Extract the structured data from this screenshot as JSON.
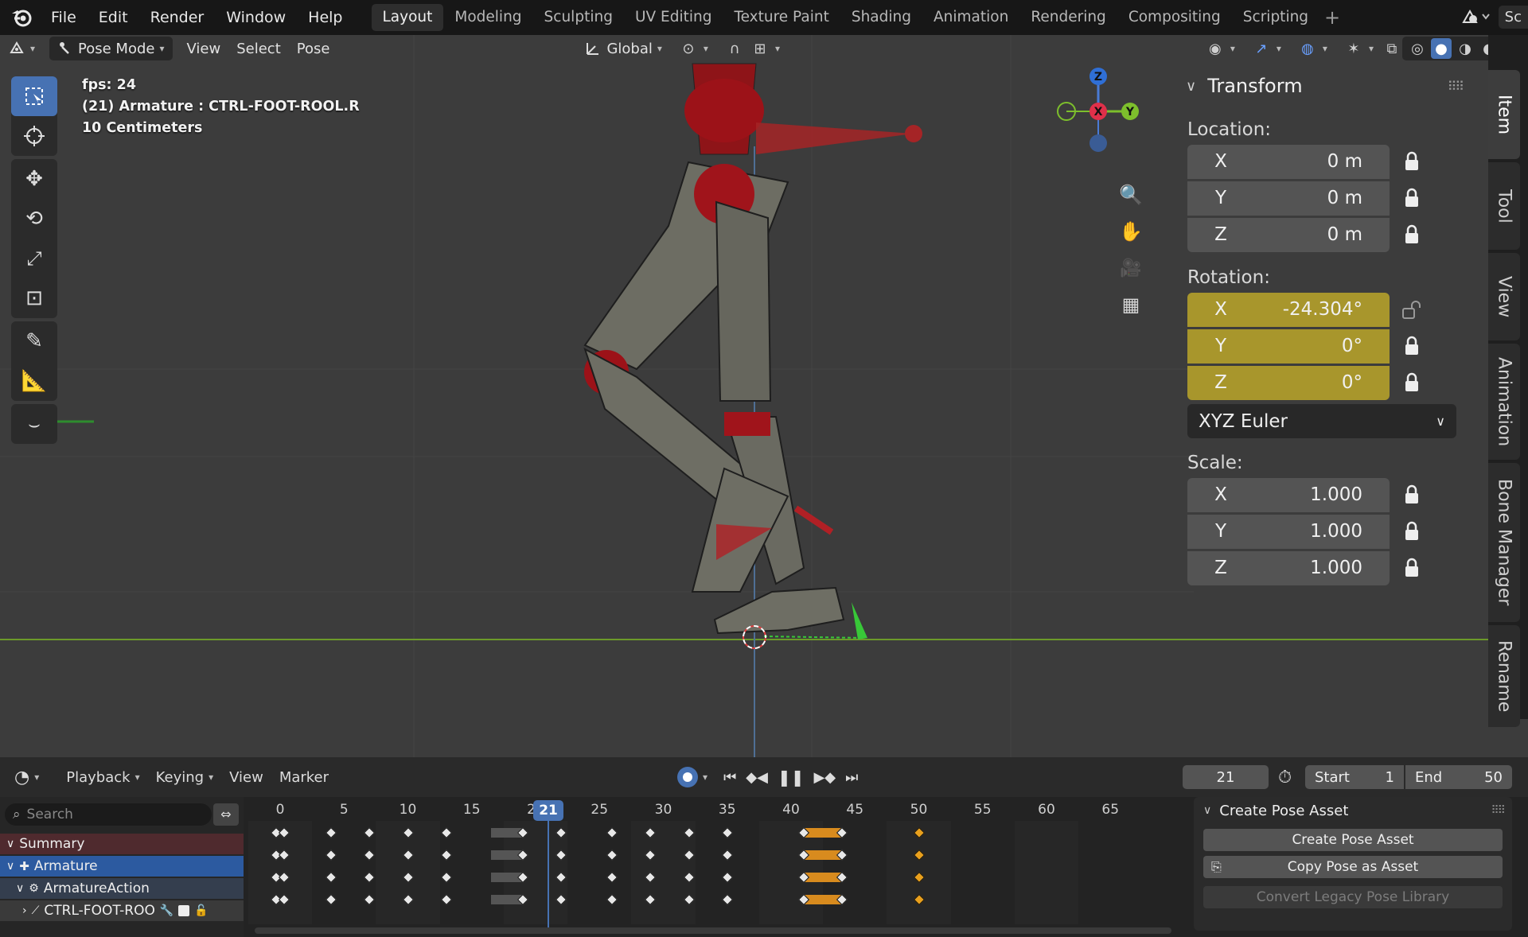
{
  "menubar": {
    "items": [
      "File",
      "Edit",
      "Render",
      "Window",
      "Help"
    ],
    "workspaces": [
      "Layout",
      "Modeling",
      "Sculpting",
      "UV Editing",
      "Texture Paint",
      "Shading",
      "Animation",
      "Rendering",
      "Compositing",
      "Scripting"
    ],
    "active_workspace": "Layout",
    "scene_label": "Sc"
  },
  "viewport_header": {
    "mode": "Pose Mode",
    "menus": [
      "View",
      "Select",
      "Pose"
    ],
    "transform_orientation": "Global"
  },
  "viewport_info": {
    "fps": "fps: 24",
    "object": "(21) Armature : CTRL-FOOT-ROOL.R",
    "scale": "10 Centimeters"
  },
  "gizmo": {
    "z": "Z",
    "x": "X",
    "y": "Y"
  },
  "transform_panel": {
    "title": "Transform",
    "location_label": "Location:",
    "location": [
      {
        "axis": "X",
        "value": "0 m"
      },
      {
        "axis": "Y",
        "value": "0 m"
      },
      {
        "axis": "Z",
        "value": "0 m"
      }
    ],
    "rotation_label": "Rotation:",
    "rotation": [
      {
        "axis": "X",
        "value": "-24.304°"
      },
      {
        "axis": "Y",
        "value": "0°"
      },
      {
        "axis": "Z",
        "value": "0°"
      }
    ],
    "rotation_mode": "XYZ Euler",
    "scale_label": "Scale:",
    "scale": [
      {
        "axis": "X",
        "value": "1.000"
      },
      {
        "axis": "Y",
        "value": "1.000"
      },
      {
        "axis": "Z",
        "value": "1.000"
      }
    ]
  },
  "side_tabs": [
    "Item",
    "Tool",
    "View",
    "Animation",
    "Bone Manager",
    "Rename"
  ],
  "timeline": {
    "menus": [
      "Playback",
      "Keying",
      "View",
      "Marker"
    ],
    "current_frame": "21",
    "start_label": "Start",
    "start": "1",
    "end_label": "End",
    "end": "50",
    "search_placeholder": "Search",
    "ticks": [
      "0",
      "5",
      "10",
      "15",
      "20",
      "25",
      "30",
      "35",
      "40",
      "45",
      "50",
      "55",
      "60",
      "65"
    ],
    "channels": [
      "Summary",
      "Armature",
      "ArmatureAction",
      "CTRL-FOOT-ROO"
    ],
    "keyframes": [
      0,
      4,
      7,
      10,
      13,
      19,
      22,
      26,
      29,
      32,
      35,
      41,
      44,
      50
    ],
    "double_key_frames": [
      0
    ],
    "hold_ranges": [
      [
        16.5,
        19,
        "grey"
      ],
      [
        41,
        44,
        "orange"
      ]
    ],
    "selected_key_frames": [
      50
    ]
  },
  "pose_asset_panel": {
    "title": "Create Pose Asset",
    "buttons": [
      "Create Pose Asset",
      "Copy Pose as Asset",
      "Convert Legacy Pose Library"
    ]
  },
  "colors": {
    "accent": "#4772b3",
    "keyed_field": "#a8962c",
    "summary_channel": "#4f2a2e",
    "selected_key": "#e9a01d"
  }
}
